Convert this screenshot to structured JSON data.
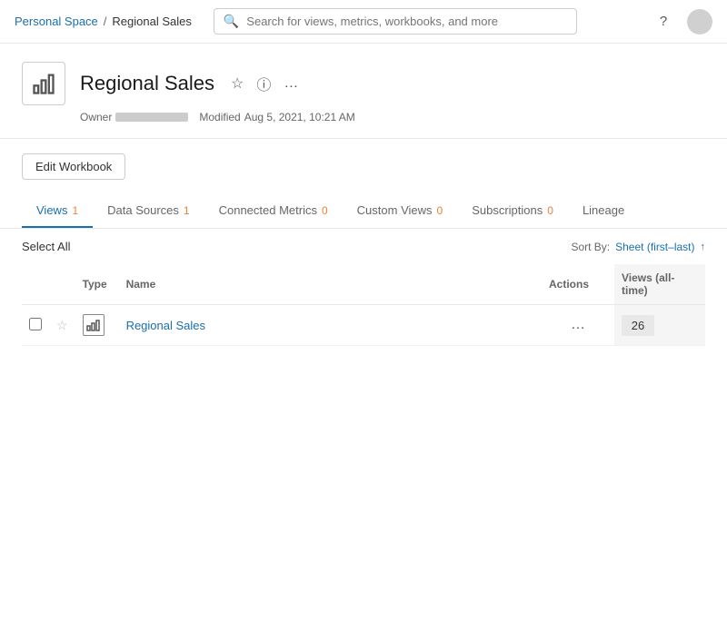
{
  "header": {
    "breadcrumb": {
      "personal": "Personal Space",
      "separator": "/",
      "current": "Regional Sales"
    },
    "search_placeholder": "Search for views, metrics, workbooks, and more",
    "help_icon": "?",
    "avatar_initials": ""
  },
  "workbook": {
    "title": "Regional Sales",
    "owner_label": "Owner",
    "modified_label": "Modified",
    "modified_date": "Aug 5, 2021, 10:21 AM",
    "edit_button": "Edit Workbook"
  },
  "tabs": [
    {
      "id": "views",
      "label": "Views",
      "count": "1",
      "active": true
    },
    {
      "id": "datasources",
      "label": "Data Sources",
      "count": "1",
      "active": false
    },
    {
      "id": "connected_metrics",
      "label": "Connected Metrics",
      "count": "0",
      "active": false
    },
    {
      "id": "custom_views",
      "label": "Custom Views",
      "count": "0",
      "active": false
    },
    {
      "id": "subscriptions",
      "label": "Subscriptions",
      "count": "0",
      "active": false
    },
    {
      "id": "lineage",
      "label": "Lineage",
      "count": "",
      "active": false
    }
  ],
  "table": {
    "sort_by_label": "Sort By:",
    "sort_value": "Sheet (first–last)",
    "sort_arrow": "↑",
    "select_all_label": "Select All",
    "columns": {
      "type": "Type",
      "name": "Name",
      "actions": "Actions",
      "views": "Views (all-time)"
    },
    "rows": [
      {
        "id": "row-1",
        "name": "Regional Sales",
        "type_icon": "bar-chart",
        "views_count": "26"
      }
    ]
  }
}
